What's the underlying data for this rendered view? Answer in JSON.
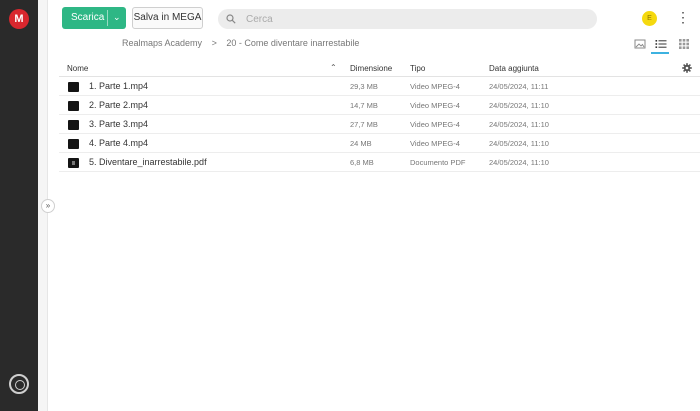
{
  "app": {
    "logo_letter": "M"
  },
  "toolbar": {
    "download_label": "Scarica",
    "save_label": "Salva in MEGA",
    "search_placeholder": "Cerca",
    "avatar_initial": "E"
  },
  "breadcrumb": {
    "root": "Realmaps Academy",
    "separator": ">",
    "current": "20 - Come diventare inarrestabile"
  },
  "table": {
    "headers": {
      "name": "Nome",
      "size": "Dimensione",
      "type": "Tipo",
      "date": "Data aggiunta"
    },
    "rows": [
      {
        "name": "1. Parte 1.mp4",
        "size": "29,3 MB",
        "type": "Video MPEG-4",
        "date": "24/05/2024, 11:11",
        "icon": "video-file-icon"
      },
      {
        "name": "2. Parte 2.mp4",
        "size": "14,7 MB",
        "type": "Video MPEG-4",
        "date": "24/05/2024, 11:10",
        "icon": "video-file-icon"
      },
      {
        "name": "3. Parte 3.mp4",
        "size": "27,7 MB",
        "type": "Video MPEG-4",
        "date": "24/05/2024, 11:10",
        "icon": "video-file-icon"
      },
      {
        "name": "4. Parte 4.mp4",
        "size": "24 MB",
        "type": "Video MPEG-4",
        "date": "24/05/2024, 11:10",
        "icon": "video-file-icon"
      },
      {
        "name": "5. Diventare_inarrestabile.pdf",
        "size": "6,8 MB",
        "type": "Documento PDF",
        "date": "24/05/2024, 11:10",
        "icon": "pdf-file-icon"
      }
    ]
  },
  "colors": {
    "accent_green": "#2eb785",
    "rail": "#2a2a2a",
    "logo_red": "#d9272e",
    "avatar_yellow": "#f5d90f",
    "active_view": "#3db2e0"
  }
}
